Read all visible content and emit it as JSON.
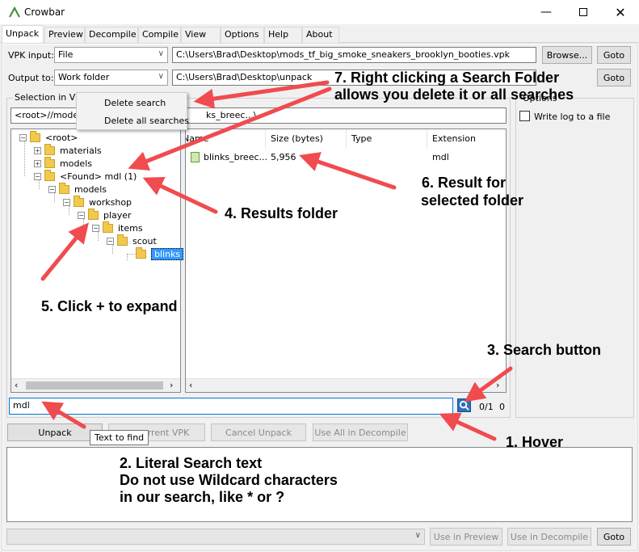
{
  "window": {
    "title": "Crowbar"
  },
  "tabs": [
    {
      "label": "Unpack",
      "active": true
    },
    {
      "label": "Preview"
    },
    {
      "label": "Decompile"
    },
    {
      "label": "Compile"
    },
    {
      "label": "View"
    },
    {
      "label": "Options"
    },
    {
      "label": "Help"
    },
    {
      "label": "About"
    }
  ],
  "vpk_input": {
    "label": "VPK input:",
    "combo_value": "File",
    "path": "C:\\Users\\Brad\\Desktop\\mods_tf_big_smoke_sneakers_brooklyn_booties.vpk",
    "browse_label": "Browse...",
    "goto_label": "Goto"
  },
  "output_to": {
    "label": "Output to:",
    "combo_value": "Work folder",
    "path": "C:\\Users\\Brad\\Desktop\\unpack",
    "goto_label": "Goto"
  },
  "selection": {
    "label": "Selection in VPK",
    "path": "<root>//models",
    "list_path": "ks_breec...\\"
  },
  "context_menu": {
    "items": [
      "Delete search",
      "Delete all searches"
    ]
  },
  "options": {
    "group_label": "Options",
    "write_log_label": "Write log to a file",
    "write_log_checked": false
  },
  "tree": [
    {
      "label": "<root>",
      "expander": "−",
      "depth": 0
    },
    {
      "label": "materials",
      "expander": "+",
      "depth": 1
    },
    {
      "label": "models",
      "expander": "+",
      "depth": 1
    },
    {
      "label": "<Found> mdl (1)",
      "expander": "−",
      "depth": 1
    },
    {
      "label": "models",
      "expander": "−",
      "depth": 2
    },
    {
      "label": "workshop",
      "expander": "−",
      "depth": 3
    },
    {
      "label": "player",
      "expander": "−",
      "depth": 4
    },
    {
      "label": "items",
      "expander": "−",
      "depth": 5
    },
    {
      "label": "scout",
      "expander": "−",
      "depth": 6
    },
    {
      "label": "blinks",
      "expander": "",
      "depth": 7,
      "selected": true
    }
  ],
  "list": {
    "columns": [
      "Name",
      "Size (bytes)",
      "Type",
      "Extension"
    ],
    "rows": [
      {
        "name": "blinks_breec...",
        "size": "5,956",
        "type": "",
        "extension": "mdl"
      }
    ]
  },
  "search": {
    "value": "mdl",
    "count": "0/1",
    "extra": "0",
    "tooltip": "Text to find"
  },
  "buttons": {
    "unpack": "Unpack",
    "unpack_current": "urrent VPK",
    "cancel": "Cancel Unpack",
    "use_all": "Use All in Decompile"
  },
  "bottom": {
    "use_preview": "Use in Preview",
    "use_decompile": "Use in Decompile",
    "goto": "Goto"
  },
  "annotations": {
    "a1": "1. Hover",
    "a2_l1": "2. Literal Search text",
    "a2_l2": "Do not use Wildcard characters",
    "a2_l3": "in our search, like * or ?",
    "a3": "3. Search button",
    "a4": "4. Results folder",
    "a5": "5. Click + to expand",
    "a6_l1": "6. Result for",
    "a6_l2": "selected folder",
    "a7_l1": "7. Right clicking a Search Folder",
    "a7_l2": "allows you delete it or all searches"
  },
  "colors": {
    "arrow": "#f04b4f",
    "selection": "#3399ff",
    "folder": "#f2c94c"
  }
}
